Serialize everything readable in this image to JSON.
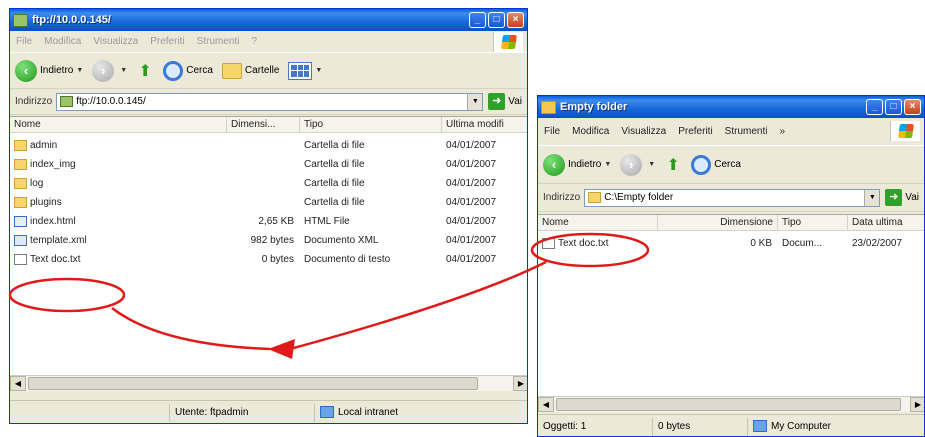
{
  "ftp_window": {
    "title": "ftp://10.0.0.145/",
    "menu": [
      "File",
      "Modifica",
      "Visualizza",
      "Preferiti",
      "Strumenti",
      "?"
    ],
    "toolbar": {
      "back": "Indietro",
      "search": "Cerca",
      "folders": "Cartelle"
    },
    "address_label": "Indirizzo",
    "address_value": "ftp://10.0.0.145/",
    "go_label": "Vai",
    "columns": [
      "Nome",
      "Dimensi...",
      "Tipo",
      "Ultima modifi"
    ],
    "rows": [
      {
        "name": "admin",
        "size": "",
        "type": "Cartella di file",
        "date": "04/01/2007",
        "icon": "folder-icon"
      },
      {
        "name": "index_img",
        "size": "",
        "type": "Cartella di file",
        "date": "04/01/2007",
        "icon": "folder-icon"
      },
      {
        "name": "log",
        "size": "",
        "type": "Cartella di file",
        "date": "04/01/2007",
        "icon": "folder-icon"
      },
      {
        "name": "plugins",
        "size": "",
        "type": "Cartella di file",
        "date": "04/01/2007",
        "icon": "folder-icon"
      },
      {
        "name": "index.html",
        "size": "2,65 KB",
        "type": "HTML File",
        "date": "04/01/2007",
        "icon": "html-file-icon"
      },
      {
        "name": "template.xml",
        "size": "982 bytes",
        "type": "Documento XML",
        "date": "04/01/2007",
        "icon": "xml-file-icon"
      },
      {
        "name": "Text doc.txt",
        "size": "0 bytes",
        "type": "Documento di testo",
        "date": "04/01/2007",
        "icon": "text-file-icon"
      }
    ],
    "status": {
      "user": "Utente: ftpadmin",
      "zone": "Local intranet"
    }
  },
  "local_window": {
    "title": "Empty folder",
    "menu": [
      "File",
      "Modifica",
      "Visualizza",
      "Preferiti",
      "Strumenti",
      "»"
    ],
    "toolbar": {
      "back": "Indietro",
      "search": "Cerca"
    },
    "address_label": "Indirizzo",
    "address_value": "C:\\Empty folder",
    "go_label": "Vai",
    "columns": [
      "Nome",
      "Dimensione",
      "Tipo",
      "Data ultima"
    ],
    "rows": [
      {
        "name": "Text doc.txt",
        "size": "0 KB",
        "type": "Docum...",
        "date": "23/02/2007",
        "icon": "text-file-icon"
      }
    ],
    "status": {
      "objects": "Oggetti: 1",
      "size": "0 bytes",
      "zone": "My Computer"
    }
  },
  "annotation": {
    "color": "#e01919"
  }
}
